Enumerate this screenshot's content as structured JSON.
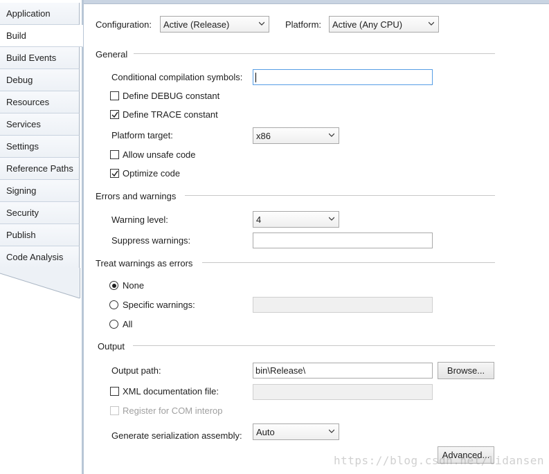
{
  "sidebar": {
    "items": [
      {
        "label": "Application"
      },
      {
        "label": "Build"
      },
      {
        "label": "Build Events"
      },
      {
        "label": "Debug"
      },
      {
        "label": "Resources"
      },
      {
        "label": "Services"
      },
      {
        "label": "Settings"
      },
      {
        "label": "Reference Paths"
      },
      {
        "label": "Signing"
      },
      {
        "label": "Security"
      },
      {
        "label": "Publish"
      },
      {
        "label": "Code Analysis"
      }
    ],
    "active": "Build"
  },
  "header": {
    "configuration_label": "Configuration:",
    "configuration_value": "Active (Release)",
    "platform_label": "Platform:",
    "platform_value": "Active (Any CPU)"
  },
  "general": {
    "heading": "General",
    "symbols_label": "Conditional compilation symbols:",
    "symbols_value": "",
    "define_debug_label": "Define DEBUG constant",
    "define_debug_checked": false,
    "define_trace_label": "Define TRACE constant",
    "define_trace_checked": true,
    "platform_target_label": "Platform target:",
    "platform_target_value": "x86",
    "allow_unsafe_label": "Allow unsafe code",
    "allow_unsafe_checked": false,
    "optimize_label": "Optimize code",
    "optimize_checked": true
  },
  "errors": {
    "heading": "Errors and warnings",
    "warning_level_label": "Warning level:",
    "warning_level_value": "4",
    "suppress_label": "Suppress warnings:",
    "suppress_value": ""
  },
  "treat_warnings": {
    "heading": "Treat warnings as errors",
    "none_label": "None",
    "specific_label": "Specific warnings:",
    "specific_value": "",
    "all_label": "All",
    "selected": "None"
  },
  "output": {
    "heading": "Output",
    "output_path_label": "Output path:",
    "output_path_value": "bin\\Release\\",
    "browse_label": "Browse...",
    "xml_doc_label": "XML documentation file:",
    "xml_doc_checked": false,
    "xml_doc_value": "",
    "com_interop_label": "Register for COM interop",
    "com_interop_checked": false,
    "serialization_label": "Generate serialization assembly:",
    "serialization_value": "Auto",
    "advanced_label": "Advanced..."
  },
  "watermark": "https://blog.csdn.net/lidansen"
}
